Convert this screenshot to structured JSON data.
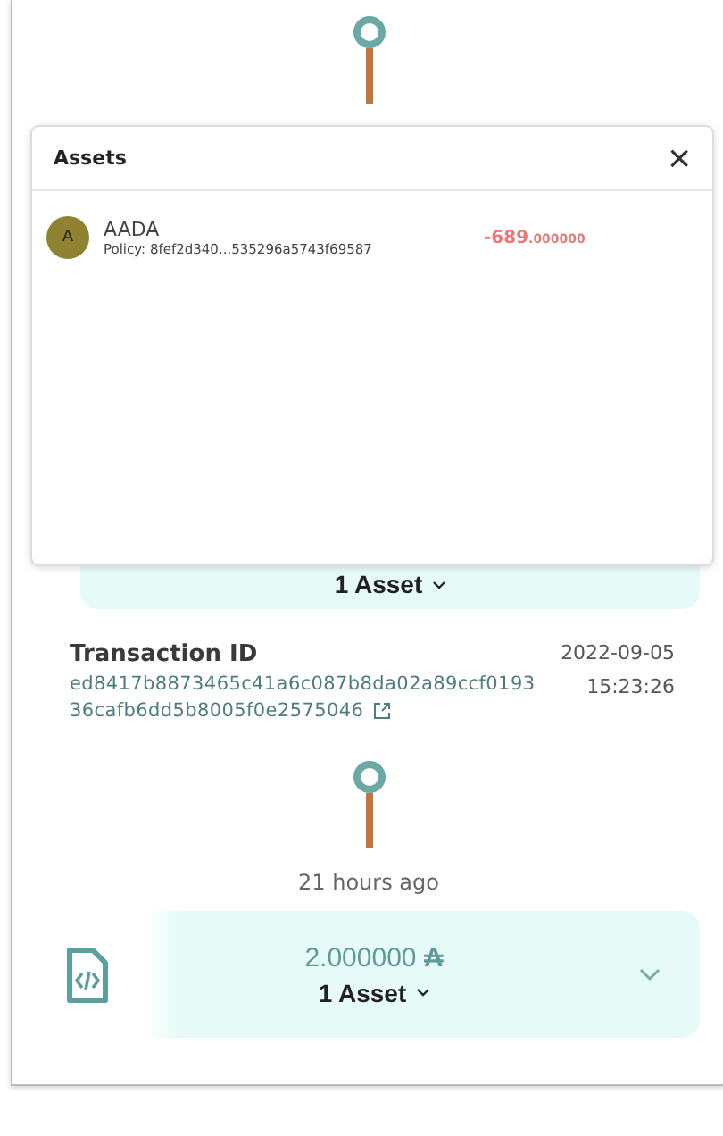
{
  "timeline_top": {
    "kind": "node"
  },
  "top_card": {
    "assets_toggle": "1 Asset"
  },
  "assets_modal": {
    "title": "Assets",
    "close": "×",
    "items": [
      {
        "avatar": "A",
        "name": "AADA",
        "policy": "Policy: 8fef2d340...535296a5743f69587",
        "amount": "-689",
        "decimals": ".000000",
        "color": "#8f8230"
      }
    ]
  },
  "transaction": {
    "label": "Transaction ID",
    "id_line_1": "ed8417b8873465c41a6c087b8da02a89ccf0193",
    "id_line_2": "36cafb6dd5b8005f0e2575046",
    "date": "2022-09-05",
    "time": "15:23:26"
  },
  "time_ago": "21 hours ago",
  "bottom_card": {
    "amount": "2.000000",
    "currency": "₳",
    "assets_toggle": "1 Asset",
    "expanded": false
  }
}
